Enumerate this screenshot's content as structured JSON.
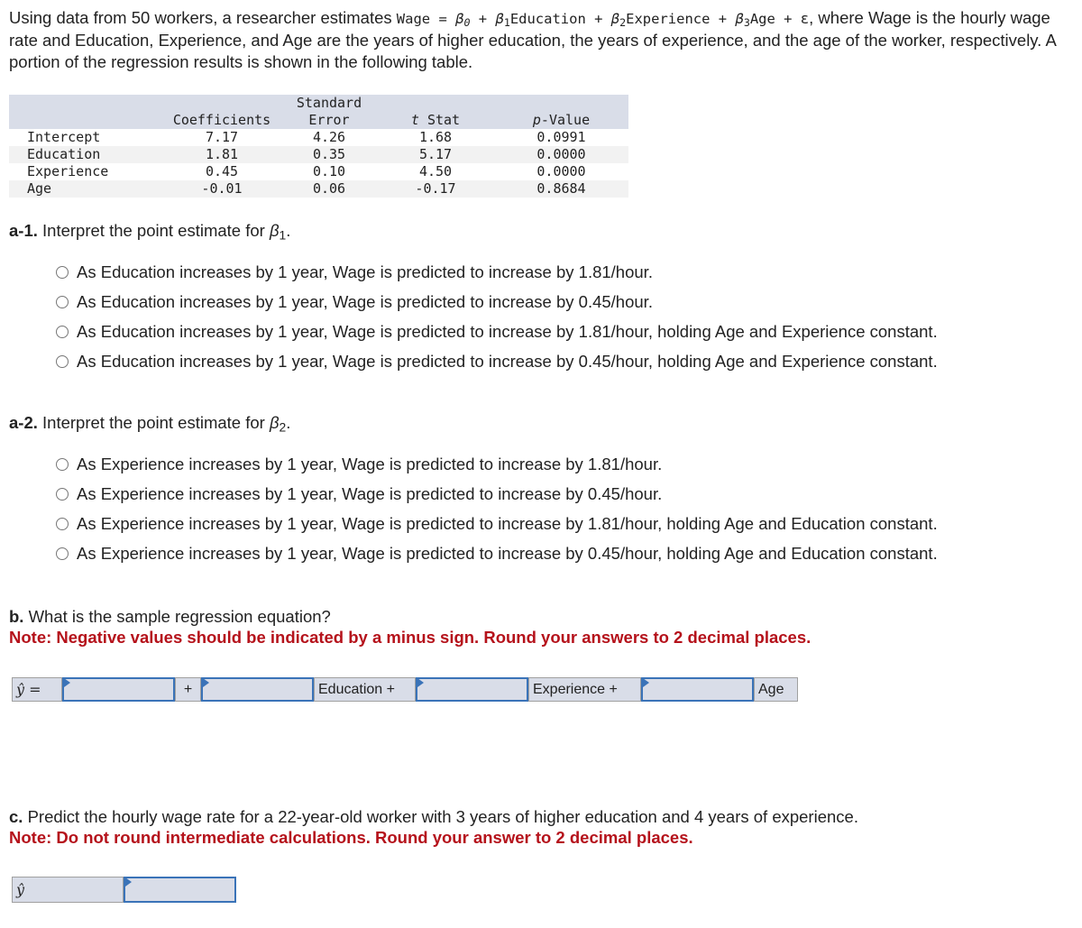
{
  "intro": {
    "before_eq": "Using data from 50 workers, a researcher estimates ",
    "eq_wage": "Wage = ",
    "eq_b0": "β",
    "eq_b0_sub": "0",
    "eq_plus1": " + ",
    "eq_b1": "β",
    "eq_b1_sub": "1",
    "eq_education": "Education + ",
    "eq_b2": "β",
    "eq_b2_sub": "2",
    "eq_experience": "Experience + ",
    "eq_b3": "β",
    "eq_b3_sub": "3",
    "eq_age": "Age + ε",
    "after_eq": ", where Wage is the hourly wage rate and Education, Experience, and Age are the years of higher education, the years of experience, and the age of the worker, respectively. A portion of the regression results is shown in the following table."
  },
  "table": {
    "headers": {
      "coefficients": "Coefficients",
      "std_error_line1": "Standard",
      "std_error_line2": "Error",
      "t_stat_italic": "t",
      "t_stat_rest": " Stat",
      "p_value_italic": "p",
      "p_value_rest": "-Value"
    },
    "rows": [
      {
        "label": "Intercept",
        "coef": "7.17",
        "se": "4.26",
        "t": "1.68",
        "p": "0.0991"
      },
      {
        "label": "Education",
        "coef": "1.81",
        "se": "0.35",
        "t": "5.17",
        "p": "0.0000"
      },
      {
        "label": "Experience",
        "coef": "0.45",
        "se": "0.10",
        "t": "4.50",
        "p": "0.0000"
      },
      {
        "label": "Age",
        "coef": "-0.01",
        "se": "0.06",
        "t": "-0.17",
        "p": "0.8684"
      }
    ]
  },
  "a1": {
    "label": "a-1.",
    "question": " Interpret the point estimate for ",
    "beta": "β",
    "beta_sub": "1",
    "end": ".",
    "options": [
      "As Education increases by 1 year, Wage is predicted to increase by 1.81/hour.",
      "As Education increases by 1 year, Wage is predicted to increase by 0.45/hour.",
      "As Education increases by 1 year, Wage is predicted to increase by 1.81/hour, holding Age and Experience constant.",
      "As Education increases by 1 year, Wage is predicted to increase by 0.45/hour, holding Age and Experience constant."
    ]
  },
  "a2": {
    "label": "a-2.",
    "question": " Interpret the point estimate for ",
    "beta": "β",
    "beta_sub": "2",
    "end": ".",
    "options": [
      "As Experience increases by 1 year, Wage is predicted to increase by 1.81/hour.",
      "As Experience increases by 1 year, Wage is predicted to increase by 0.45/hour.",
      "As Experience increases by 1 year, Wage is predicted to increase by 1.81/hour, holding Age and Education constant.",
      "As Experience increases by 1 year, Wage is predicted to increase by 0.45/hour, holding Age and Education constant."
    ]
  },
  "b": {
    "label": "b.",
    "question": " What is the sample regression equation?",
    "note": "Note: Negative values should be indicated by a minus sign. Round your answers to 2 decimal places.",
    "yhat_label": "ŷ =",
    "plus_label": "+",
    "education_label": "Education +",
    "experience_label": "Experience +",
    "age_label": "Age",
    "inputs": [
      "",
      "",
      "",
      ""
    ]
  },
  "c": {
    "label": "c.",
    "question": " Predict the hourly wage rate for a 22-year-old worker with 3 years of higher education and 4 years of experience.",
    "note": "Note: Do not round intermediate calculations. Round your answer to 2 decimal places.",
    "yhat_label": "ŷ",
    "input": ""
  }
}
